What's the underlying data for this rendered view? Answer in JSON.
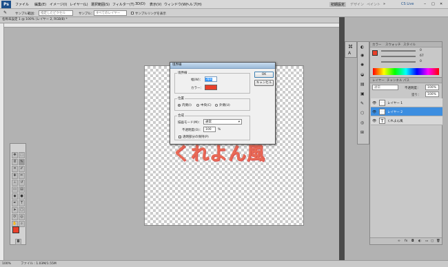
{
  "menubar": {
    "items": [
      "ファイル",
      "編集(E)",
      "イメージ(I)",
      "レイヤー(L)",
      "選択範囲(S)",
      "フィルター(T)",
      "3D(D)",
      "表示(V)",
      "ウィンドウ(W)",
      "ヘルプ(H)"
    ],
    "workspace_buttons": [
      "初期設定",
      "デザイン",
      "ペイント",
      "»"
    ],
    "cs_live": "CS Live"
  },
  "options": {
    "sample_range_label": "サンプル範囲：",
    "sample_range_value": "指定したピクセル",
    "sample_label": "サンプル：",
    "sample_value": "すべてのレイヤー",
    "show_ring_label": "サンプルリングを表示"
  },
  "document": {
    "tab_title": "名称未設定 1 @ 100% (レイヤー 2, RGB/8) *",
    "canvas_text": "くれよん風",
    "status": "100%",
    "file_info": "ファイル : 1.03M/1.55M"
  },
  "dialog": {
    "title": "境界線",
    "stroke_group": "境界線",
    "width_label": "幅(W)：",
    "width_value": "3px",
    "color_label": "カラー：",
    "color_value": "#e8402a",
    "position_group": "位置",
    "positions": [
      "内側(I)",
      "中央(C)",
      "外側(U)"
    ],
    "selected_position": 0,
    "blend_group": "合成",
    "blend_label": "描画モード(M)：",
    "blend_value": "通常",
    "opacity_label": "不透明度(O)：",
    "opacity_value": "100",
    "opacity_unit": "%",
    "preserve_label": "透明部分の保持(P)",
    "ok": "OK",
    "cancel": "キャンセル"
  },
  "color_panel": {
    "tabs": [
      "カラー",
      "スウォッチ",
      "スタイル"
    ],
    "values": [
      "0",
      "67",
      "0"
    ],
    "fg": "#e8402a"
  },
  "layers_panel": {
    "tabs": [
      "レイヤー",
      "チャンネル",
      "パス"
    ],
    "mode": "通常",
    "opacity_label": "不透明度：",
    "opacity": "100%",
    "fill_label": "塗り：",
    "fill": "100%",
    "layers": [
      "レイヤー 1",
      "レイヤー 2",
      "くれよん風"
    ],
    "selected_layer": 1
  },
  "toolbox": {
    "fg_color": "#e8402a",
    "bg_color": "#ffffff"
  }
}
